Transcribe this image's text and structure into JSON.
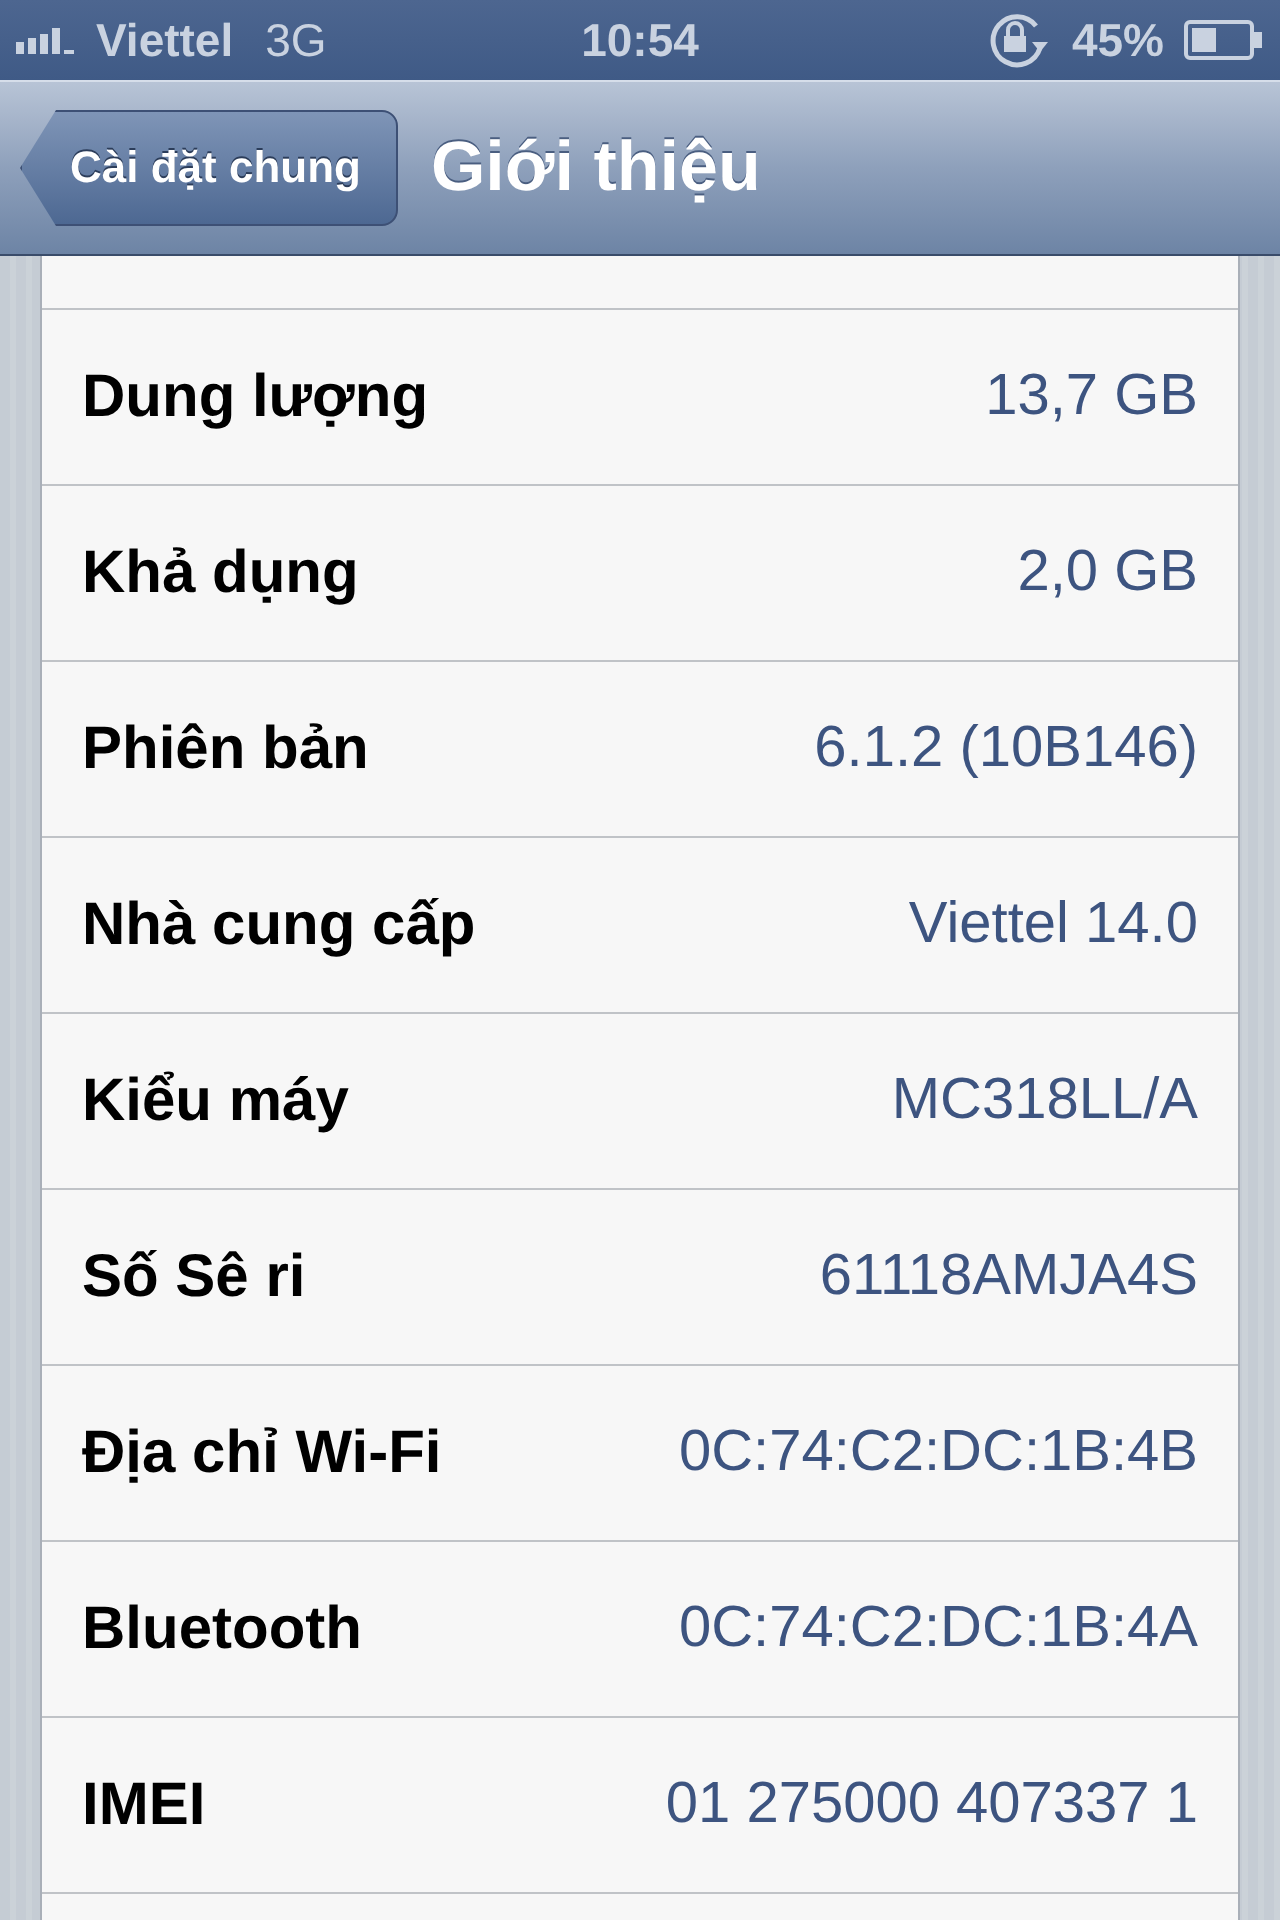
{
  "status_bar": {
    "carrier": "Viettel",
    "network": "3G",
    "time": "10:54",
    "battery_percent": "45%"
  },
  "nav_bar": {
    "back_button": "Cài đặt chung",
    "title": "Giới thiệu"
  },
  "rows": [
    {
      "label": "Dung lượng",
      "value": "13,7 GB"
    },
    {
      "label": "Khả dụng",
      "value": "2,0 GB"
    },
    {
      "label": "Phiên bản",
      "value": "6.1.2 (10B146)"
    },
    {
      "label": "Nhà cung cấp",
      "value": "Viettel 14.0"
    },
    {
      "label": "Kiểu máy",
      "value": "MC318LL/A"
    },
    {
      "label": "Số Sê ri",
      "value": "61118AMJA4S"
    },
    {
      "label": "Địa chỉ Wi-Fi",
      "value": "0C:74:C2:DC:1B:4B"
    },
    {
      "label": "Bluetooth",
      "value": "0C:74:C2:DC:1B:4A"
    },
    {
      "label": "IMEI",
      "value": "01 275000 407337 1"
    }
  ]
}
